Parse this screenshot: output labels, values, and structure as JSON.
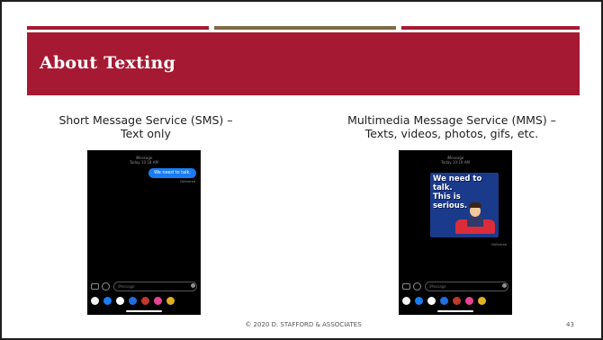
{
  "slide": {
    "title": "About Texting",
    "footer": "© 2020 D. STAFFORD & ASSOCIATES",
    "page_number": "43",
    "colors": {
      "title_band": "#a51a32",
      "accent_gold": "#7d6a45",
      "accent_maroon": "#a51a32"
    }
  },
  "left": {
    "caption_line1": "Short Message Service (SMS) –",
    "caption_line2": "Text only",
    "phone": {
      "header_line1": "iMessage",
      "header_line2": "Today 10:18 AM",
      "bubble_text": "We need to talk.",
      "delivered": "Delivered",
      "input_placeholder": "iMessage",
      "icons": [
        "camera-icon",
        "app-store-icon",
        "microphone-icon"
      ]
    }
  },
  "right": {
    "caption_line1": "Multimedia Message Service (MMS) –",
    "caption_line2": "Texts, videos, photos, gifs, etc.",
    "phone": {
      "header_line1": "iMessage",
      "header_line2": "Today 10:19 AM",
      "sticker_line1": "We need to talk.",
      "sticker_line2": "This is",
      "sticker_line3": "serious.",
      "delivered": "Delivered",
      "input_placeholder": "iMessage",
      "icons": [
        "camera-icon",
        "app-store-icon",
        "microphone-icon"
      ]
    }
  },
  "app_tray_colors": [
    "#f2f2f2",
    "#1a7cf5",
    "#ffffff",
    "#1f6fe0",
    "#c0392b",
    "#e84393",
    "#e0b020"
  ]
}
